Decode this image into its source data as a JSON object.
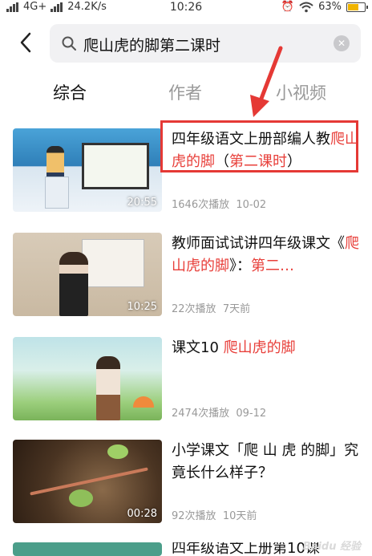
{
  "status_bar": {
    "signal": "ull",
    "network": "4G+",
    "signal2": "ull",
    "speed": "24.2K/s",
    "time": "10:26",
    "battery": "63%"
  },
  "search": {
    "query": "爬山虎的脚第二课时",
    "clear": "✕"
  },
  "tabs": [
    {
      "label": "综合",
      "active": true
    },
    {
      "label": "作者",
      "active": false
    },
    {
      "label": "小视频",
      "active": false
    }
  ],
  "results": [
    {
      "title_plain": "四年级语文上册部编人教",
      "title_highlight": "爬山虎的脚",
      "title_tail_plain": "（",
      "title_tail_highlight": "第二课时",
      "title_end": "）",
      "duration": "20:55",
      "plays": "1646次播放",
      "date": "10-02"
    },
    {
      "title_plain": "教师面试试讲四年级课文《",
      "title_highlight": "爬山虎的脚",
      "title_tail_plain": "》：",
      "title_tail_highlight": "第二…",
      "duration": "10:25",
      "plays": "22次播放",
      "date": "7天前"
    },
    {
      "title_plain": "课文10 ",
      "title_highlight": "爬山虎的脚",
      "duration": "",
      "plays": "2474次播放",
      "date": "09-12"
    },
    {
      "title_plain": "小学课文「爬 山 虎 的脚」究竟长什么样子？",
      "duration": "00:28",
      "plays": "92次播放",
      "date": "10天前"
    },
    {
      "title_plain": "四年级语文上册第10课"
    }
  ],
  "watermark": "Baidu 经验",
  "colors": {
    "highlight": "#e8403b",
    "annotation": "#e53935"
  }
}
